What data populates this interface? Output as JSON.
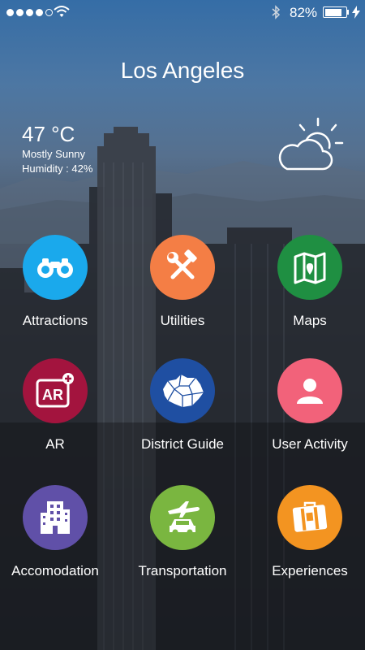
{
  "status_bar": {
    "battery_percent": "82%",
    "battery_level": 0.82
  },
  "city": "Los Angeles",
  "weather": {
    "temperature": "47 °C",
    "condition": "Mostly Sunny",
    "humidity": "Humidity : 42%",
    "icon": "partly-sunny-icon"
  },
  "menu": [
    {
      "label": "Attractions",
      "icon": "binoculars-icon",
      "color": "#1aa9ec"
    },
    {
      "label": "Utilities",
      "icon": "tools-icon",
      "color": "#f47e45"
    },
    {
      "label": "Maps",
      "icon": "map-icon",
      "color": "#1f8f42"
    },
    {
      "label": "AR",
      "icon": "ar-icon",
      "color": "#a3143e"
    },
    {
      "label": "District Guide",
      "icon": "district-map-icon",
      "color": "#1f4fa2"
    },
    {
      "label": "User Activity",
      "icon": "user-icon",
      "color": "#f2627a"
    },
    {
      "label": "Accomodation",
      "icon": "building-icon",
      "color": "#6050a8"
    },
    {
      "label": "Transportation",
      "icon": "transport-icon",
      "color": "#7ab640"
    },
    {
      "label": "Experiences",
      "icon": "suitcase-icon",
      "color": "#f39421"
    }
  ]
}
